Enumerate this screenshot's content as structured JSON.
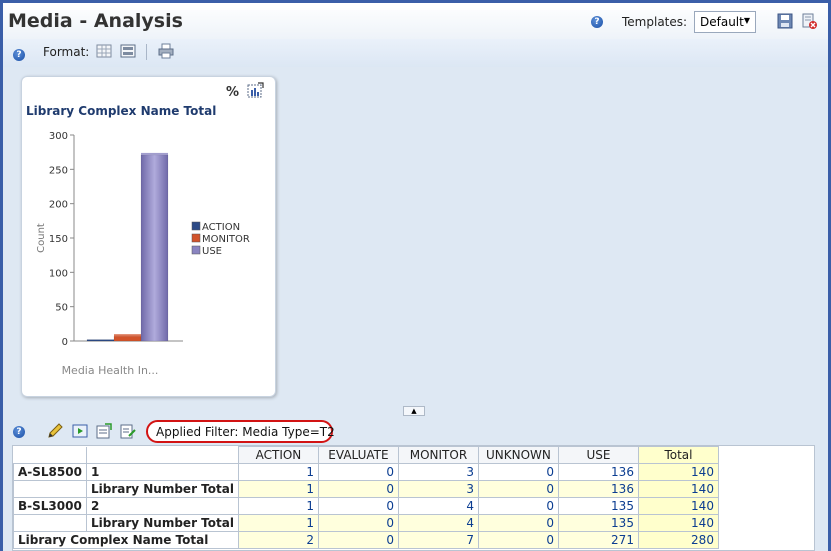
{
  "page": {
    "title": "Media - Analysis"
  },
  "header": {
    "templates_label": "Templates:",
    "template_value": "Default"
  },
  "format_bar": {
    "label": "Format:"
  },
  "chart": {
    "title": "Library Complex Name Total"
  },
  "chart_data": {
    "type": "bar",
    "title": "Library Complex Name Total",
    "xlabel": "Media Health In...",
    "ylabel": "Count",
    "ylim": [
      0,
      300
    ],
    "yticks": [
      0,
      50,
      100,
      150,
      200,
      250,
      300
    ],
    "categories": [
      "Media Health In..."
    ],
    "series": [
      {
        "name": "ACTION",
        "values": [
          2
        ],
        "color": "#2c4a86"
      },
      {
        "name": "MONITOR",
        "values": [
          7
        ],
        "color": "#d2532a"
      },
      {
        "name": "USE",
        "values": [
          271
        ],
        "color": "#8a84c0"
      }
    ],
    "legend_position": "right",
    "grid": false
  },
  "filter": {
    "text": "Applied Filter: Media Type=T2"
  },
  "table": {
    "columns": [
      "ACTION",
      "EVALUATE",
      "MONITOR",
      "UNKNOWN",
      "USE",
      "Total"
    ],
    "rows": [
      {
        "group": "A-SL8500",
        "label": "1",
        "values": [
          "1",
          "0",
          "3",
          "0",
          "136",
          "140"
        ],
        "subtotal": false
      },
      {
        "group": "",
        "label": "Library Number Total",
        "values": [
          "1",
          "0",
          "3",
          "0",
          "136",
          "140"
        ],
        "subtotal": true
      },
      {
        "group": "B-SL3000",
        "label": "2",
        "values": [
          "1",
          "0",
          "4",
          "0",
          "135",
          "140"
        ],
        "subtotal": false
      },
      {
        "group": "",
        "label": "Library Number Total",
        "values": [
          "1",
          "0",
          "4",
          "0",
          "135",
          "140"
        ],
        "subtotal": true
      }
    ],
    "grand_total": {
      "label": "Library Complex Name Total",
      "values": [
        "2",
        "0",
        "7",
        "0",
        "271",
        "280"
      ]
    }
  }
}
